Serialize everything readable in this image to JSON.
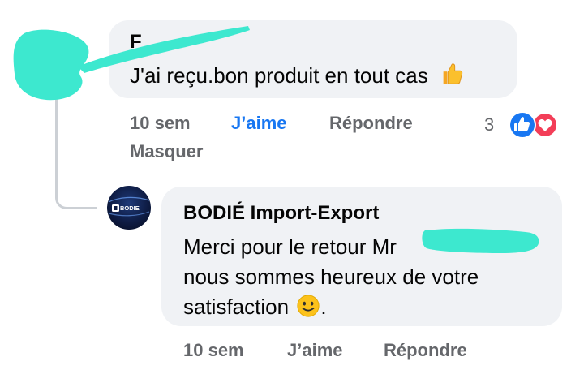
{
  "comments": [
    {
      "author": "F",
      "text": "J'ai reçu.bon produit en tout cas",
      "emoji": "thumbs-up-emoji",
      "time": "10 sem",
      "like_label": "J’aime",
      "reply_label": "Répondre",
      "hide_label": "Masquer",
      "reaction_count": "3",
      "reactions": [
        "like-reaction-icon",
        "love-reaction-icon"
      ]
    },
    {
      "author": "BODIÉ Import-Export",
      "avatar_text": "BODIE",
      "text_before": "Merci pour le retour Mr",
      "text_after": "nous sommes heureux de votre satisfaction",
      "emoji": "slightly-smiling-face-emoji",
      "trailing": ".",
      "time": "10 sem",
      "like_label": "J’aime",
      "reply_label": "Répondre"
    }
  ],
  "colors": {
    "bubble": "#f0f2f5",
    "meta_text": "#65676b",
    "liked_blue": "#1877f2",
    "redaction": "#3de8cf",
    "love_red": "#f33e58"
  }
}
